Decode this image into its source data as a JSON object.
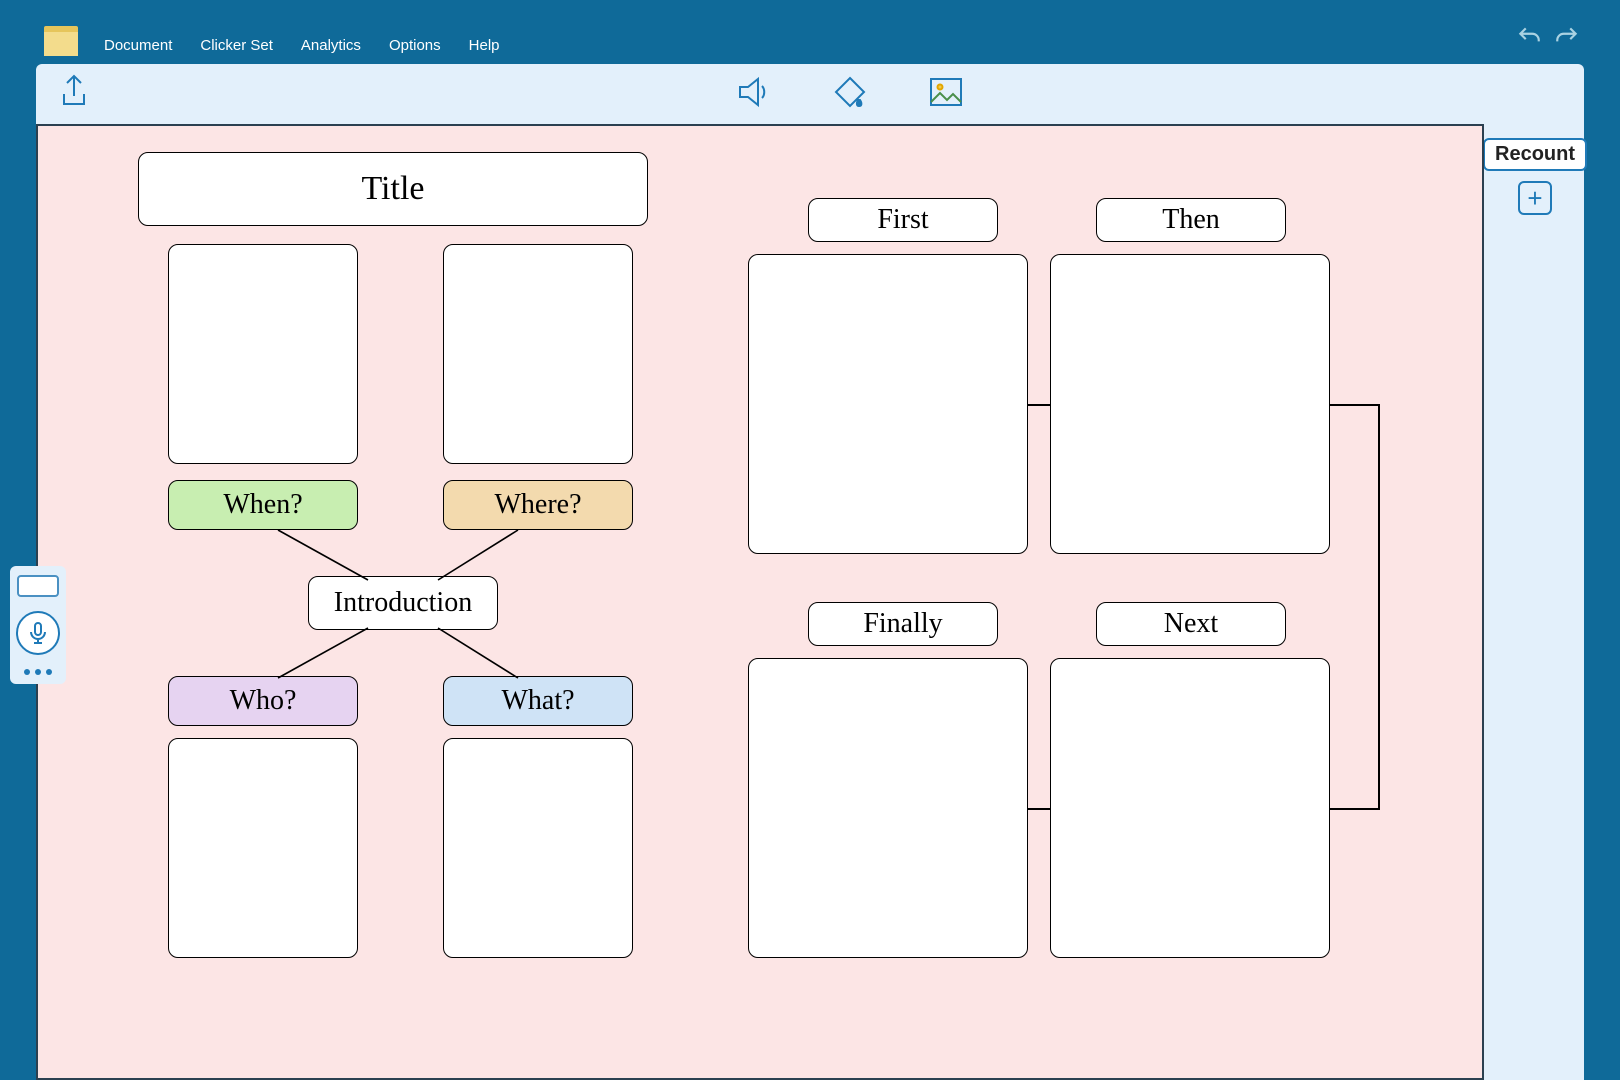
{
  "menu": {
    "items": [
      "Document",
      "Clicker Set",
      "Analytics",
      "Options",
      "Help"
    ]
  },
  "tab_label": "Recount",
  "add_label": "+",
  "canvas": {
    "title": "Title",
    "intro": "Introduction",
    "q_when": "When?",
    "q_where": "Where?",
    "q_who": "Who?",
    "q_what": "What?",
    "seq_first": "First",
    "seq_then": "Then",
    "seq_next": "Next",
    "seq_finally": "Finally"
  },
  "colors": {
    "when": "#c8eeb1",
    "where": "#f3daae",
    "who": "#e6d3f1",
    "what": "#cfe3f6"
  }
}
